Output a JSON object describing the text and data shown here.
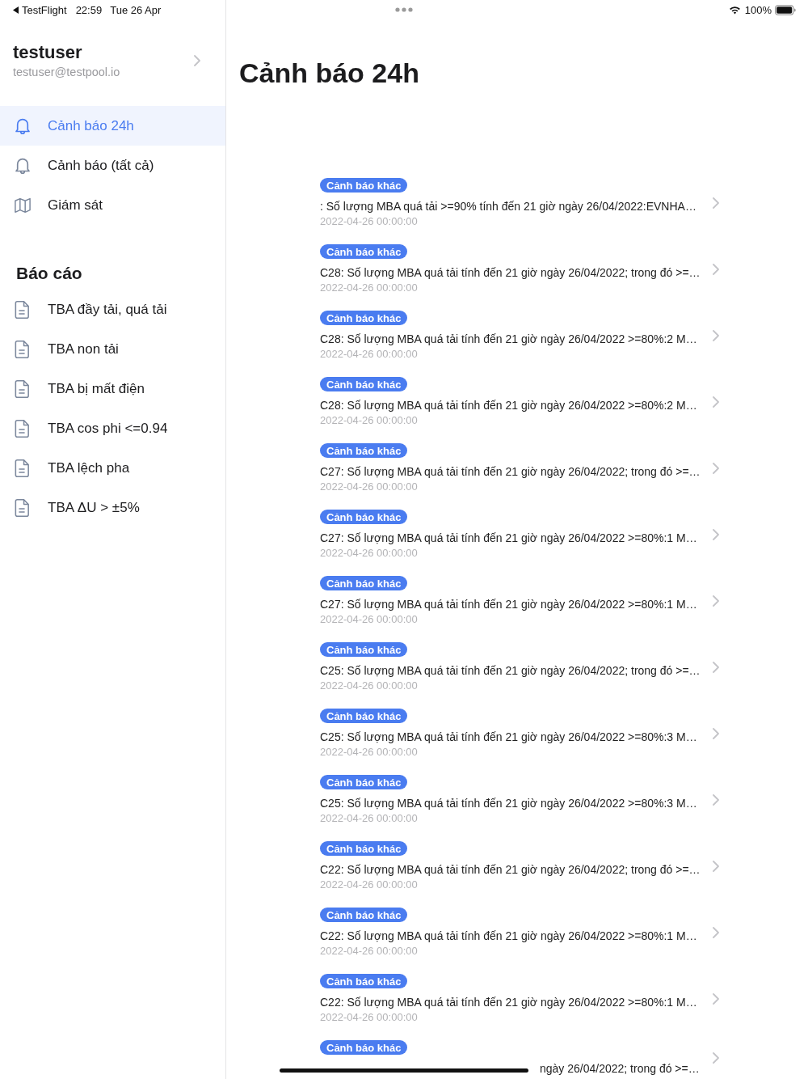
{
  "status_bar": {
    "back_app": "TestFlight",
    "time": "22:59",
    "date": "Tue 26 Apr",
    "battery": "100%"
  },
  "sidebar": {
    "user": {
      "name": "testuser",
      "email": "testuser@testpool.io"
    },
    "nav_items": [
      {
        "kind": "alerts",
        "label": "Cảnh báo 24h",
        "selected": true
      },
      {
        "kind": "alerts",
        "label": "Cảnh báo (tất cả)",
        "selected": false
      },
      {
        "kind": "monitor",
        "label": "Giám sát",
        "selected": false
      }
    ],
    "reports": {
      "title": "Báo cáo",
      "items": [
        {
          "label": "TBA đầy tải, quá tải",
          "selected": false
        },
        {
          "label": "TBA non tải",
          "selected": false
        },
        {
          "label": "TBA bị mất điện",
          "selected": false
        },
        {
          "label": "TBA cos phi <=0.94",
          "selected": false
        },
        {
          "label": "TBA lệch pha",
          "selected": false
        },
        {
          "label": "TBA ΔU > ±5%",
          "selected": false
        }
      ]
    }
  },
  "page": {
    "title": "Cảnh báo 24h",
    "alerts": [
      {
        "tag": "Cảnh báo khác",
        "message": ": Số lượng MBA quá tải >=90% tính đến 21 giờ ngày 26/04/2022:EVNHA…",
        "time": "2022-04-26 00:00:00",
        "covered": false
      },
      {
        "tag": "Cảnh báo khác",
        "message": "C28: Số lượng MBA quá tải tính đến 21 giờ ngày 26/04/2022; trong đó >=…",
        "time": "2022-04-26 00:00:00",
        "covered": false
      },
      {
        "tag": "Cảnh báo khác",
        "message": "C28: Số lượng MBA quá tải tính đến 21 giờ ngày 26/04/2022 >=80%:2 M…",
        "time": "2022-04-26 00:00:00",
        "covered": false
      },
      {
        "tag": "Cảnh báo khác",
        "message": "C28: Số lượng MBA quá tải tính đến 21 giờ ngày 26/04/2022 >=80%:2 M…",
        "time": "2022-04-26 00:00:00",
        "covered": false
      },
      {
        "tag": "Cảnh báo khác",
        "message": "C27: Số lượng MBA quá tải tính đến 21 giờ ngày 26/04/2022; trong đó >=…",
        "time": "2022-04-26 00:00:00",
        "covered": false
      },
      {
        "tag": "Cảnh báo khác",
        "message": "C27: Số lượng MBA quá tải tính đến 21 giờ ngày 26/04/2022 >=80%:1 M…",
        "time": "2022-04-26 00:00:00",
        "covered": false
      },
      {
        "tag": "Cảnh báo khác",
        "message": "C27: Số lượng MBA quá tải tính đến 21 giờ ngày 26/04/2022 >=80%:1 M…",
        "time": "2022-04-26 00:00:00",
        "covered": false
      },
      {
        "tag": "Cảnh báo khác",
        "message": "C25: Số lượng MBA quá tải tính đến 21 giờ ngày 26/04/2022; trong đó >=…",
        "time": "2022-04-26 00:00:00",
        "covered": false
      },
      {
        "tag": "Cảnh báo khác",
        "message": "C25: Số lượng MBA quá tải tính đến 21 giờ ngày 26/04/2022 >=80%:3 M…",
        "time": "2022-04-26 00:00:00",
        "covered": false
      },
      {
        "tag": "Cảnh báo khác",
        "message": "C25: Số lượng MBA quá tải tính đến 21 giờ ngày 26/04/2022 >=80%:3 M…",
        "time": "2022-04-26 00:00:00",
        "covered": false
      },
      {
        "tag": "Cảnh báo khác",
        "message": "C22: Số lượng MBA quá tải tính đến 21 giờ ngày 26/04/2022; trong đó >=…",
        "time": "2022-04-26 00:00:00",
        "covered": false
      },
      {
        "tag": "Cảnh báo khác",
        "message": "C22: Số lượng MBA quá tải tính đến 21 giờ ngày 26/04/2022 >=80%:1 M…",
        "time": "2022-04-26 00:00:00",
        "covered": false
      },
      {
        "tag": "Cảnh báo khác",
        "message": "C22: Số lượng MBA quá tải tính đến 21 giờ ngày 26/04/2022 >=80%:1 M…",
        "time": "2022-04-26 00:00:00",
        "covered": false
      },
      {
        "tag": "Cảnh báo khác",
        "message": "ngày 26/04/2022; trong đó >=…",
        "covered": true
      }
    ]
  }
}
